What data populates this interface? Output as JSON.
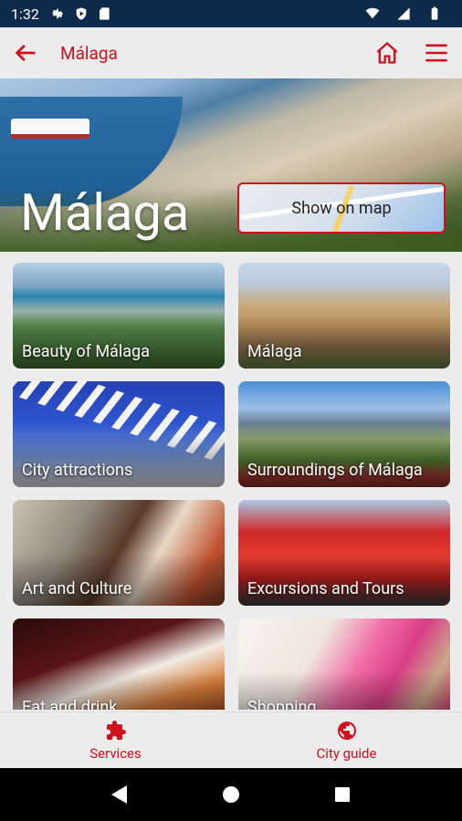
{
  "status_bar": {
    "time": "1:32"
  },
  "app_bar": {
    "title": "Málaga"
  },
  "hero": {
    "city_name": "Málaga",
    "map_button_label": "Show on map"
  },
  "tiles": [
    {
      "label": "Beauty of Málaga"
    },
    {
      "label": "Málaga"
    },
    {
      "label": "City attractions"
    },
    {
      "label": "Surroundings of Málaga"
    },
    {
      "label": "Art and Culture"
    },
    {
      "label": "Excursions and Tours"
    },
    {
      "label": "Eat and drink"
    },
    {
      "label": "Shopping"
    }
  ],
  "bottom_nav": {
    "items": [
      {
        "label": "Services",
        "icon": "puzzle-icon"
      },
      {
        "label": "City guide",
        "icon": "globe-icon"
      }
    ]
  },
  "colors": {
    "accent": "#d0101c",
    "status_bar": "#0d2a4a",
    "background": "#ececec"
  }
}
